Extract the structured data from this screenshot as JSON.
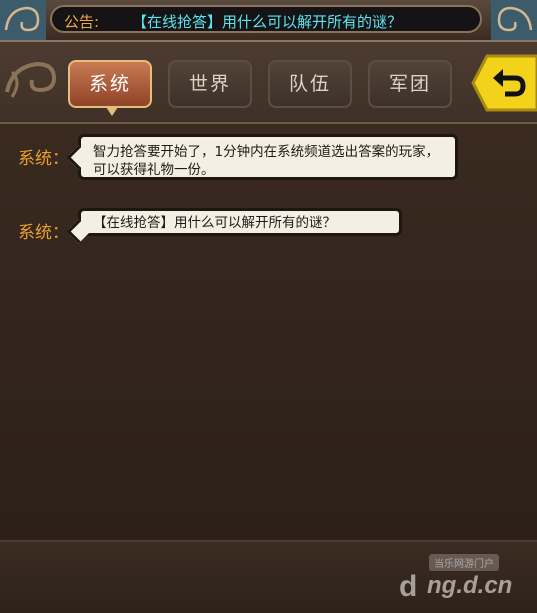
{
  "announcement": {
    "label": "公告:",
    "message": "【在线抢答】用什么可以解开所有的谜？"
  },
  "tabs": [
    {
      "label": "系统",
      "active": true
    },
    {
      "label": "世界",
      "active": false
    },
    {
      "label": "队伍",
      "active": false
    },
    {
      "label": "军团",
      "active": false
    }
  ],
  "messages": [
    {
      "sender": "系统：",
      "text": "智力抢答要开始了，1分钟内在系统频道选出答案的玩家，可以获得礼物一份。"
    },
    {
      "sender": "系统：",
      "text": "【在线抢答】用什么可以解开所有的谜？"
    }
  ],
  "watermark": {
    "tag": "当乐网游门户",
    "url": "ng.d.cn"
  },
  "icons": {
    "back": "back-arrow-icon",
    "ornament": "scroll-ornament-icon"
  },
  "colors": {
    "accent": "#e9a02f",
    "announce_text": "#59e6ef",
    "active_tab": "#b05a36"
  }
}
